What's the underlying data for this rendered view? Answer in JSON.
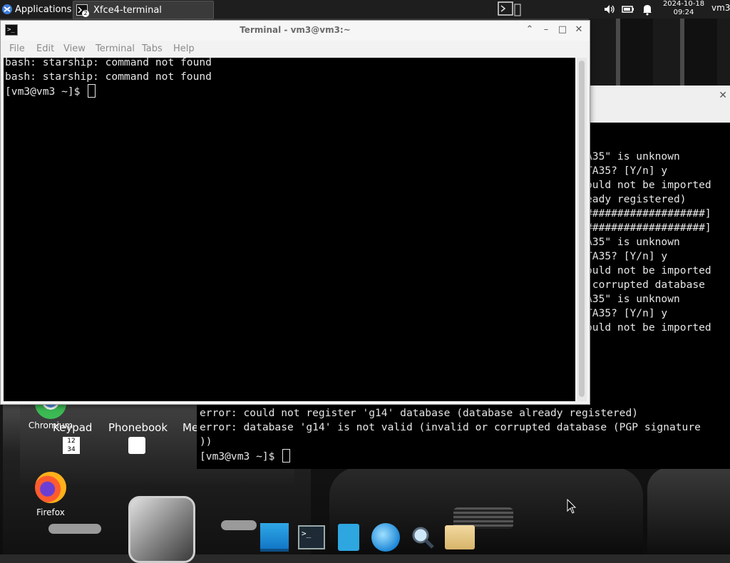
{
  "panel": {
    "applications_label": "Applications",
    "task_label": "Xfce4-terminal",
    "task_badge": "2",
    "clock_date": "2024-10-18",
    "clock_time": "09:24",
    "user": "vm3"
  },
  "desktop_icons": [
    {
      "label": "Chromium"
    },
    {
      "label": "Firefox"
    }
  ],
  "wallpaper_labels": {
    "keypad": "Keypad",
    "phonebook": "Phonebook",
    "me": "Me"
  },
  "window": {
    "title": "Terminal - vm3@vm3:~",
    "menu": [
      "File",
      "Edit",
      "View",
      "Terminal",
      "Tabs",
      "Help"
    ],
    "lines": [
      "bash: starship: command not found",
      "bash: starship: command not found"
    ],
    "prompt": "[vm3@vm3 ~]$ "
  },
  "back_terminal": {
    "right_lines": [
      "A35\" is unknown",
      "TA35? [Y/n] y",
      "ould not be imported",
      "eady registered)",
      "",
      "",
      "###################]",
      "",
      "###################]",
      "A35\" is unknown",
      "TA35? [Y/n] y",
      "ould not be imported",
      " corrupted database",
      "",
      "",
      "A35\" is unknown",
      "TA35? [Y/n] y",
      "ould not be imported"
    ],
    "bottom_lines": [
      "error: could not register 'g14' database (database already registered)",
      "error: database 'g14' is not valid (invalid or corrupted database (PGP signature",
      "))"
    ],
    "prompt": "[vm3@vm3 ~]$ "
  },
  "dock": [
    "workspace-app",
    "terminal-app",
    "file-manager-app",
    "web-browser-app",
    "search-app",
    "files-folder-app"
  ],
  "colors": {
    "panel_bg": "#1e1e1e",
    "terminal_bg": "#000000",
    "terminal_fg": "#e6e6e6",
    "titlebar_bg": "#f6f6f6"
  }
}
